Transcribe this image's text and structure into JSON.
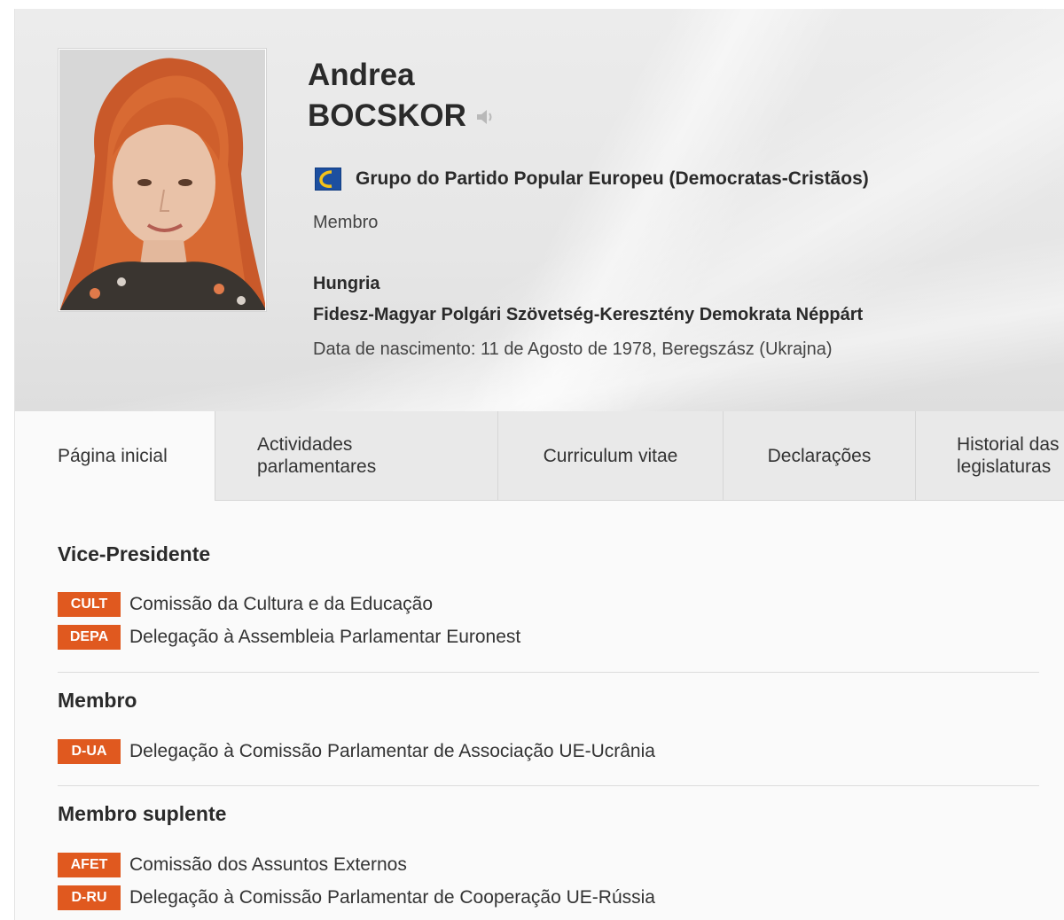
{
  "profile": {
    "first_name": "Andrea",
    "last_name": "BOCSKOR",
    "group": "Grupo do Partido Popular Europeu (Democratas-Cristãos)",
    "role": "Membro",
    "country": "Hungria",
    "party": "Fidesz-Magyar Polgári Szövetség-Keresztény Demokrata Néppárt",
    "birth": "Data de nascimento: 11 de Agosto de 1978, Beregszász (Ukrajna)"
  },
  "tabs": [
    {
      "label": "Página inicial",
      "active": true
    },
    {
      "label": "Actividades\nparlamentares",
      "active": false
    },
    {
      "label": "Curriculum vitae",
      "active": false
    },
    {
      "label": "Declarações",
      "active": false
    },
    {
      "label": "Historial das\nlegislaturas",
      "active": false
    }
  ],
  "sections": [
    {
      "title": "Vice-Presidente",
      "items": [
        {
          "code": "CULT",
          "name": "Comissão da Cultura e da Educação"
        },
        {
          "code": "DEPA",
          "name": "Delegação à Assembleia Parlamentar Euronest"
        }
      ]
    },
    {
      "title": "Membro",
      "items": [
        {
          "code": "D-UA",
          "name": "Delegação à Comissão Parlamentar de Associação UE-Ucrânia"
        }
      ]
    },
    {
      "title": "Membro suplente",
      "items": [
        {
          "code": "AFET",
          "name": "Comissão dos Assuntos Externos"
        },
        {
          "code": "D-RU",
          "name": "Delegação à Comissão Parlamentar de Cooperação UE-Rússia"
        }
      ]
    }
  ],
  "colors": {
    "badge": "#e0591f",
    "group_logo": "#1c4fa0"
  },
  "icons": {
    "speaker": "speaker-icon",
    "group_logo": "epp-group-logo-icon"
  }
}
